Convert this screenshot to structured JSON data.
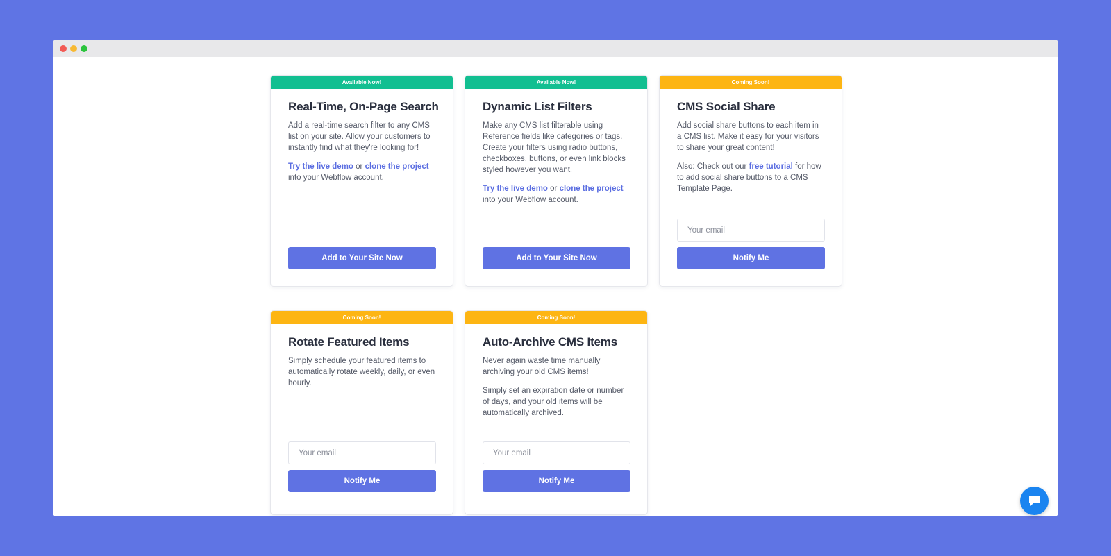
{
  "colors": {
    "background": "#5f74e4",
    "available_ribbon": "#12bf91",
    "coming_soon_ribbon": "#fdb513",
    "button": "#5f72e3",
    "link": "#5b6ee1",
    "chat_button": "#1a84f0"
  },
  "cards": [
    {
      "ribbon": "Available Now!",
      "title": "Real-Time, On-Page Search",
      "description": "Add a real-time search filter to any CMS list on your site. Allow your customers to instantly find what they're looking for!",
      "link_1": "Try the live demo",
      "separator": " or ",
      "link_2": "clone the project",
      "suffix": " into your Webflow account.",
      "button": "Add to Your Site Now"
    },
    {
      "ribbon": "Available Now!",
      "title": "Dynamic List Filters",
      "description": "Make any CMS list filterable using Reference fields like categories or tags. Create your filters using radio buttons, checkboxes, buttons, or even link blocks styled however you want.",
      "link_1": "Try the live demo",
      "separator": " or ",
      "link_2": "clone the project",
      "suffix": " into your Webflow account.",
      "button": "Add to Your Site Now"
    },
    {
      "ribbon": "Coming Soon!",
      "title": "CMS Social Share",
      "description": "Add social share buttons to each item in a CMS list. Make it easy for your visitors to share your great content!",
      "prefix": "Also: Check out our ",
      "link": "free tutorial",
      "suffix": " for how to add social share buttons to a CMS Template Page.",
      "email_placeholder": "Your email",
      "button": "Notify Me"
    },
    {
      "ribbon": "Coming Soon!",
      "title": "Rotate Featured Items",
      "description": "Simply schedule your featured items to automatically rotate weekly, daily, or even hourly.",
      "email_placeholder": "Your email",
      "button": "Notify Me"
    },
    {
      "ribbon": "Coming Soon!",
      "title": "Auto-Archive CMS Items",
      "description": "Never again waste time manually archiving your old CMS items!",
      "description_2": "Simply set an expiration date or number of days, and your old items will be automatically archived.",
      "email_placeholder": "Your email",
      "button": "Notify Me"
    }
  ],
  "chat": {
    "icon": "chat-bubble-icon"
  }
}
